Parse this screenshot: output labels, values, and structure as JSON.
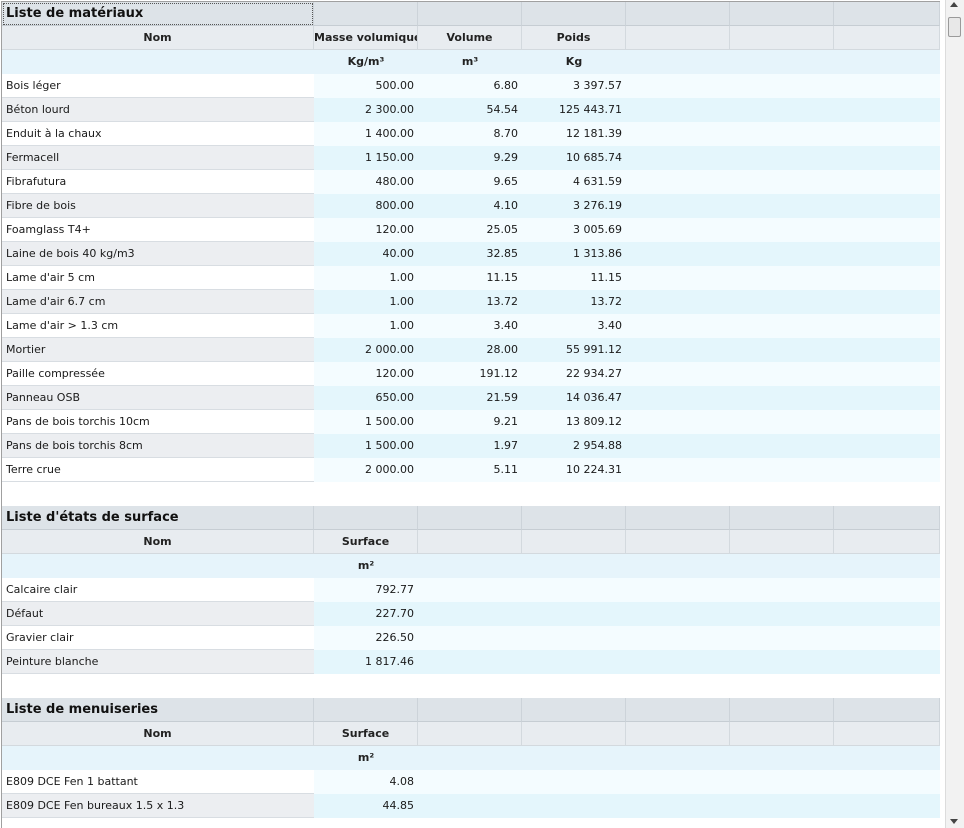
{
  "materials": {
    "title": "Liste de matériaux",
    "headers": [
      "Nom",
      "Masse volumique",
      "Volume",
      "Poids"
    ],
    "units": [
      "",
      "Kg/m³",
      "m³",
      "Kg"
    ],
    "rows": [
      [
        "Bois léger",
        "500.00",
        "6.80",
        "3 397.57"
      ],
      [
        "Béton lourd",
        "2 300.00",
        "54.54",
        "125 443.71"
      ],
      [
        "Enduit à la chaux",
        "1 400.00",
        "8.70",
        "12 181.39"
      ],
      [
        "Fermacell",
        "1 150.00",
        "9.29",
        "10 685.74"
      ],
      [
        "Fibrafutura",
        "480.00",
        "9.65",
        "4 631.59"
      ],
      [
        "Fibre de bois",
        "800.00",
        "4.10",
        "3 276.19"
      ],
      [
        "Foamglass T4+",
        "120.00",
        "25.05",
        "3 005.69"
      ],
      [
        "Laine de bois 40 kg/m3",
        "40.00",
        "32.85",
        "1 313.86"
      ],
      [
        "Lame d'air 5 cm",
        "1.00",
        "11.15",
        "11.15"
      ],
      [
        "Lame d'air 6.7 cm",
        "1.00",
        "13.72",
        "13.72"
      ],
      [
        "Lame d'air > 1.3 cm",
        "1.00",
        "3.40",
        "3.40"
      ],
      [
        "Mortier",
        "2 000.00",
        "28.00",
        "55 991.12"
      ],
      [
        "Paille compressée",
        "120.00",
        "191.12",
        "22 934.27"
      ],
      [
        "Panneau OSB",
        "650.00",
        "21.59",
        "14 036.47"
      ],
      [
        "Pans de bois torchis 10cm",
        "1 500.00",
        "9.21",
        "13 809.12"
      ],
      [
        "Pans de bois torchis 8cm",
        "1 500.00",
        "1.97",
        "2 954.88"
      ],
      [
        "Terre crue",
        "2 000.00",
        "5.11",
        "10 224.31"
      ]
    ]
  },
  "surfaces": {
    "title": "Liste d'états de surface",
    "headers": [
      "Nom",
      "Surface"
    ],
    "units": [
      "",
      "m²"
    ],
    "rows": [
      [
        "Calcaire clair",
        "792.77"
      ],
      [
        "Défaut",
        "227.70"
      ],
      [
        "Gravier clair",
        "226.50"
      ],
      [
        "Peinture blanche",
        "1 817.46"
      ]
    ]
  },
  "menuiseries": {
    "title": "Liste de menuiseries",
    "headers": [
      "Nom",
      "Surface"
    ],
    "units": [
      "",
      "m²"
    ],
    "rows": [
      [
        "E809 DCE Fen 1 battant",
        "4.08"
      ],
      [
        "E809 DCE Fen bureaux 1.5 x 1.3",
        "44.85"
      ]
    ]
  }
}
